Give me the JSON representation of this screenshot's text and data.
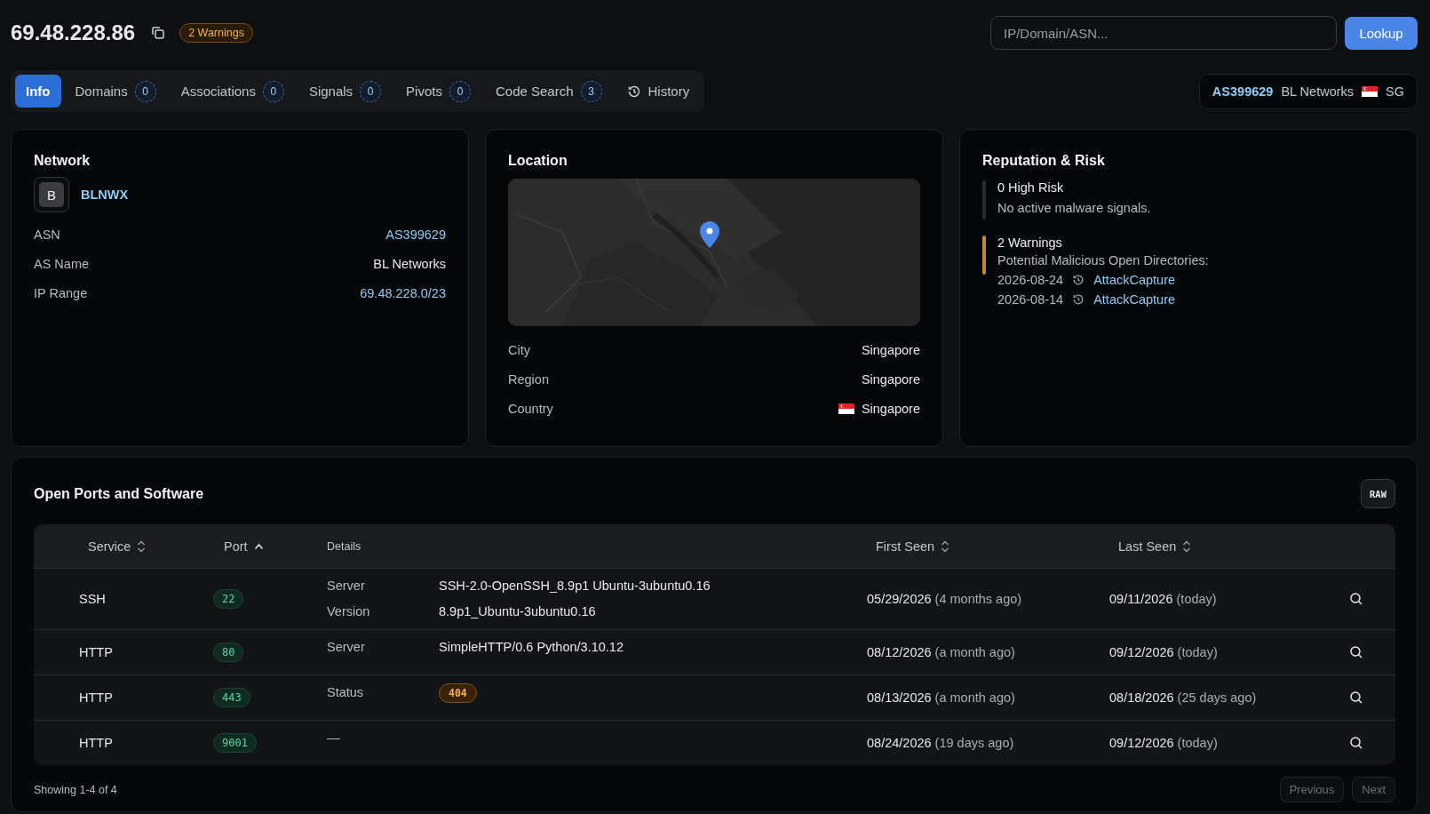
{
  "header": {
    "ip": "69.48.228.86",
    "badge": "2 Warnings",
    "search": {
      "placeholder": "IP/Domain/ASN..."
    },
    "lookup": "Lookup"
  },
  "tabs": [
    {
      "label": "Info",
      "selected": true
    },
    {
      "label": "Domains",
      "count": "0",
      "selected": false
    },
    {
      "label": "Associations",
      "count": "0",
      "selected": false
    },
    {
      "label": "Signals",
      "count": "0",
      "selected": false
    },
    {
      "label": "Pivots",
      "count": "0",
      "selected": false
    },
    {
      "label": "Code Search",
      "count": "3",
      "selected": false
    },
    {
      "label": "History",
      "kind": "history",
      "selected": false
    }
  ],
  "asn_chip": {
    "asn": "AS399629",
    "name": "BL Networks",
    "country": "SG"
  },
  "network": {
    "title": "Network",
    "avatar": "B",
    "org": "BLNWX",
    "rows": [
      {
        "label": "ASN",
        "value": "AS399629",
        "kind": "link"
      },
      {
        "label": "AS Name",
        "value": "BL Networks",
        "kind": "plain"
      },
      {
        "label": "IP Range",
        "value": "69.48.228.0/23",
        "kind": "link"
      }
    ]
  },
  "location": {
    "title": "Location",
    "rows": [
      {
        "label": "City",
        "value": "Singapore",
        "kind": "plain"
      },
      {
        "label": "Region",
        "value": "Singapore",
        "kind": "plain"
      },
      {
        "label": "Country",
        "value": "Singapore",
        "kind": "flag"
      }
    ]
  },
  "reputation": {
    "title": "Reputation & Risk",
    "items": [
      {
        "heading": "0 High Risk",
        "color": "#2a2b2f",
        "text": "No active malware signals."
      },
      {
        "heading": "2 Warnings",
        "color": "#c0892f",
        "text": "Potential Malicious Open Directories:",
        "entries": [
          {
            "date": "2026-08-24",
            "source": "AttackCapture"
          },
          {
            "date": "2026-08-14",
            "source": "AttackCapture"
          }
        ]
      }
    ]
  },
  "ports": {
    "title": "Open Ports and Software",
    "raw": "RAW",
    "columns": [
      {
        "label": "Service",
        "sortable": true,
        "sorted": false
      },
      {
        "label": "Port",
        "sortable": true,
        "sorted": true
      },
      {
        "label": "Details",
        "sortable": false
      },
      {
        "label": "First Seen",
        "sortable": true,
        "sorted": false
      },
      {
        "label": "Last Seen",
        "sortable": true,
        "sorted": false
      }
    ],
    "rows": [
      {
        "service": "SSH",
        "port": "22",
        "details": [
          {
            "kind": "pair",
            "key": "Server",
            "value": "SSH-2.0-OpenSSH_8.9p1 Ubuntu-3ubuntu0.16"
          },
          {
            "kind": "pair",
            "key": "Version",
            "value": "8.9p1_Ubuntu-3ubuntu0.16"
          }
        ],
        "first_seen": "05/29/2026",
        "first_ago": "(4 months ago)",
        "last_seen": "09/11/2026",
        "last_ago": "(today)"
      },
      {
        "service": "HTTP",
        "port": "80",
        "details": [
          {
            "kind": "pair",
            "key": "Server",
            "value": "SimpleHTTP/0.6 Python/3.10.12"
          }
        ],
        "first_seen": "08/12/2026",
        "first_ago": "(a month ago)",
        "last_seen": "09/12/2026",
        "last_ago": "(today)"
      },
      {
        "service": "HTTP",
        "port": "443",
        "details": [
          {
            "kind": "badge",
            "key": "Status",
            "value": "404"
          }
        ],
        "first_seen": "08/13/2026",
        "first_ago": "(a month ago)",
        "last_seen": "08/18/2026",
        "last_ago": "(25 days ago)"
      },
      {
        "service": "HTTP",
        "port": "9001",
        "details": [
          {
            "kind": "empty",
            "key": "—"
          }
        ],
        "first_seen": "08/24/2026",
        "first_ago": "(19 days ago)",
        "last_seen": "09/12/2026",
        "last_ago": "(today)"
      }
    ],
    "footer": "Showing 1-4 of 4",
    "pagination": [
      {
        "label": "Previous",
        "disabled": true
      },
      {
        "label": "Next",
        "disabled": true
      }
    ]
  }
}
